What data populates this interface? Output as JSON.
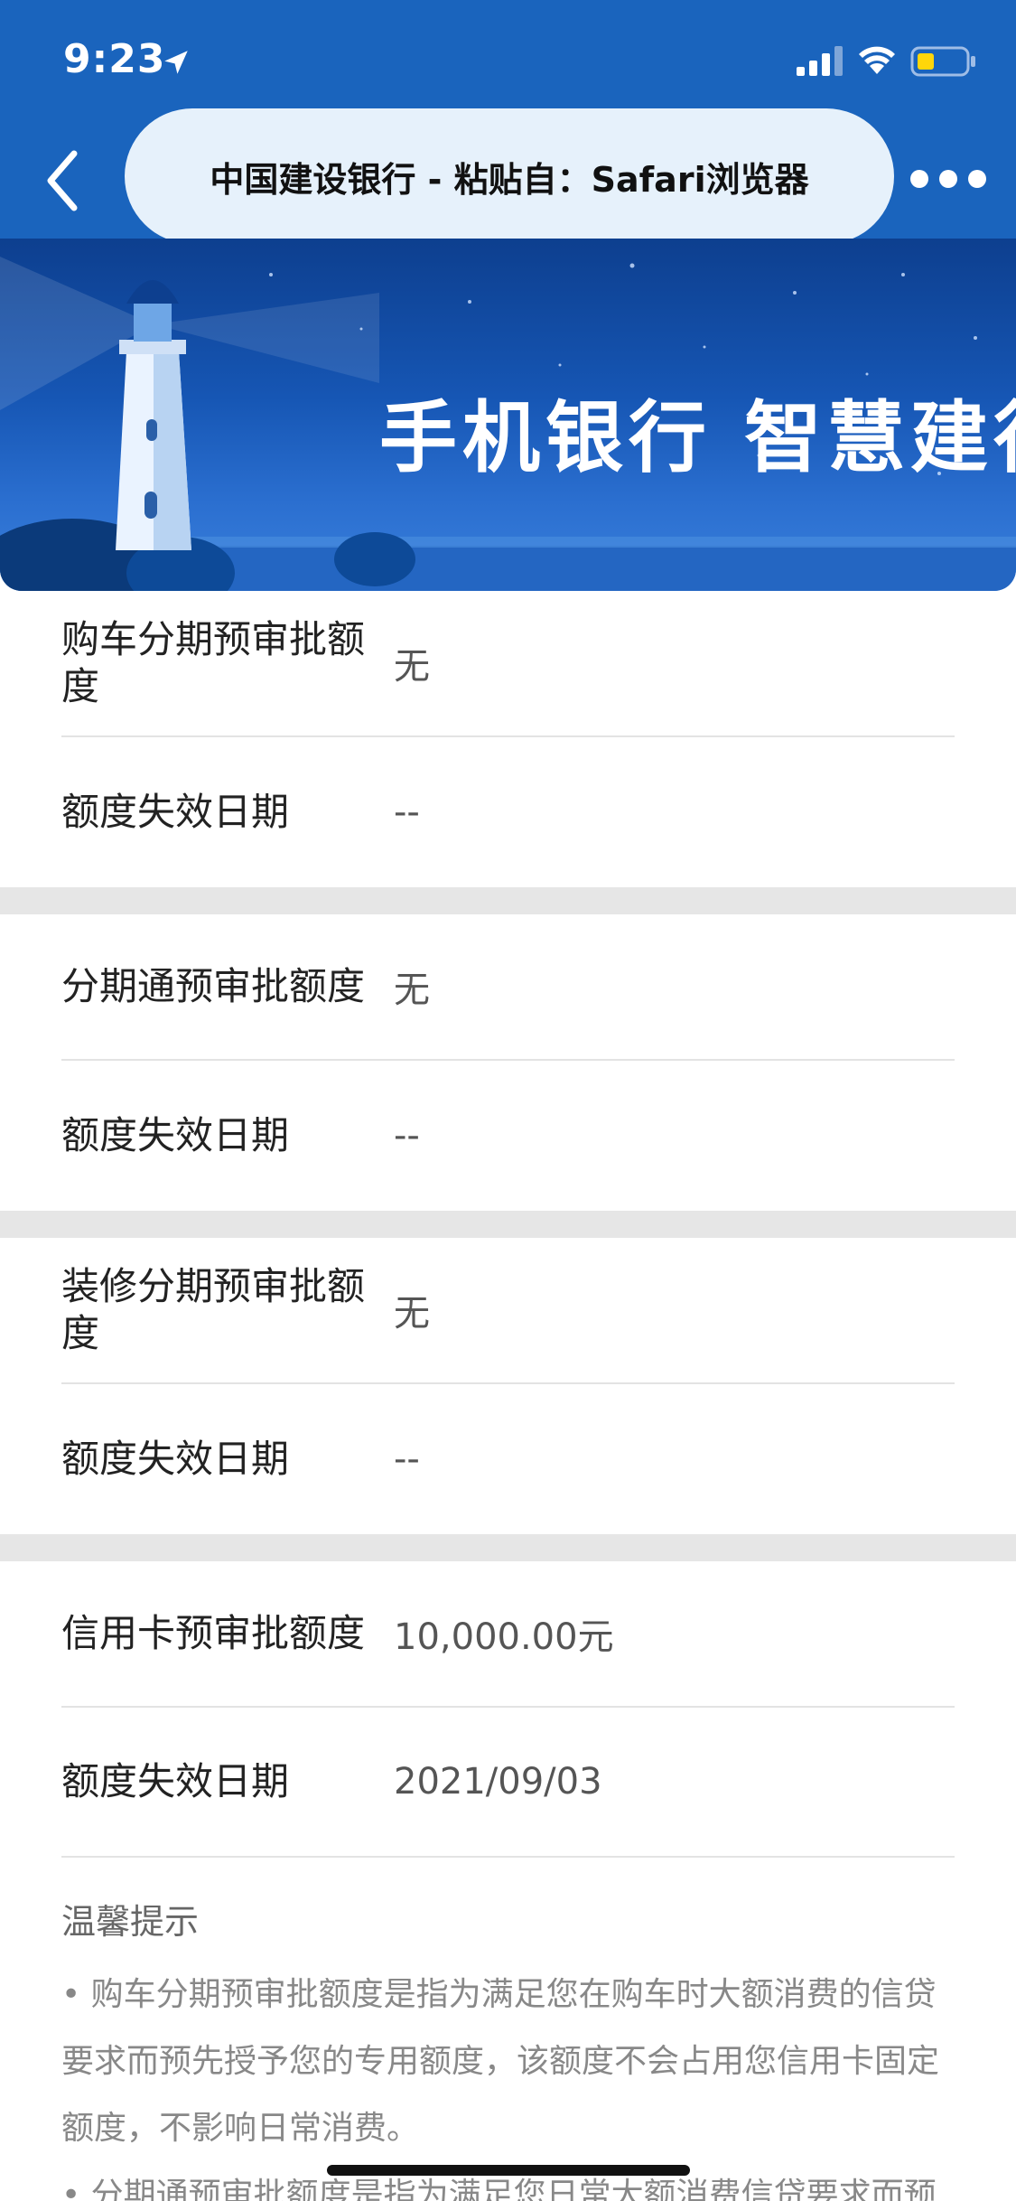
{
  "status_bar": {
    "time": "9:23",
    "icons": [
      "location-arrow-icon",
      "signal-icon",
      "wifi-icon",
      "battery-icon"
    ]
  },
  "nav": {
    "title": "中国建设银行 - 粘贴自：Safari浏览器",
    "back_icon": "chevron-left-icon",
    "more_icon": "more-dots-icon"
  },
  "banner": {
    "text": "手机银行 智慧建行"
  },
  "sections": [
    {
      "label": "购车分期预审批额度",
      "value": "无",
      "expire_label": "额度失效日期",
      "expire_value": "--"
    },
    {
      "label": "分期通预审批额度",
      "value": "无",
      "expire_label": "额度失效日期",
      "expire_value": "--"
    },
    {
      "label": "装修分期预审批额度",
      "value": "无",
      "expire_label": "额度失效日期",
      "expire_value": "--"
    },
    {
      "label": "信用卡预审批额度",
      "value": "10,000.00元",
      "expire_label": "额度失效日期",
      "expire_value": "2021/09/03"
    }
  ],
  "tips": {
    "title": "温馨提示",
    "text": "• 购车分期预审批额度是指为满足您在购车时大额消费的信贷要求而预先授予您的专用额度，该额度不会占用您信用卡固定额度，不影响日常消费。",
    "text2": "• 分期通预审批额度是指为满足您日常大额消费信贷要求而预"
  },
  "colors": {
    "header_blue": "#1a64bd",
    "pill_bg": "#e6f1fb",
    "divider": "#e3e3e3",
    "section_gap": "#e6e6e6"
  }
}
